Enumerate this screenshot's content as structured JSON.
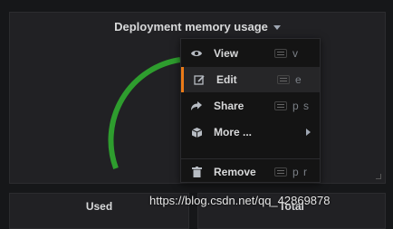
{
  "panel": {
    "title": "Deployment memory usage",
    "gauge_color": "#2e9d2e"
  },
  "bottom_panels": [
    {
      "title": "Used"
    },
    {
      "title": "Total"
    }
  ],
  "menu": {
    "items": [
      {
        "label": "View",
        "icon": "eye-icon",
        "shortcut": "v"
      },
      {
        "label": "Edit",
        "icon": "edit-icon",
        "shortcut": "e",
        "active": true
      },
      {
        "label": "Share",
        "icon": "share-icon",
        "shortcut": "p s"
      },
      {
        "label": "More ...",
        "icon": "cube-icon",
        "submenu": true
      },
      {
        "label": "Remove",
        "icon": "trash-icon",
        "shortcut": "p r"
      }
    ],
    "accent": "#eb7b18"
  },
  "watermark": "https://blog.csdn.net/qq_42869878"
}
